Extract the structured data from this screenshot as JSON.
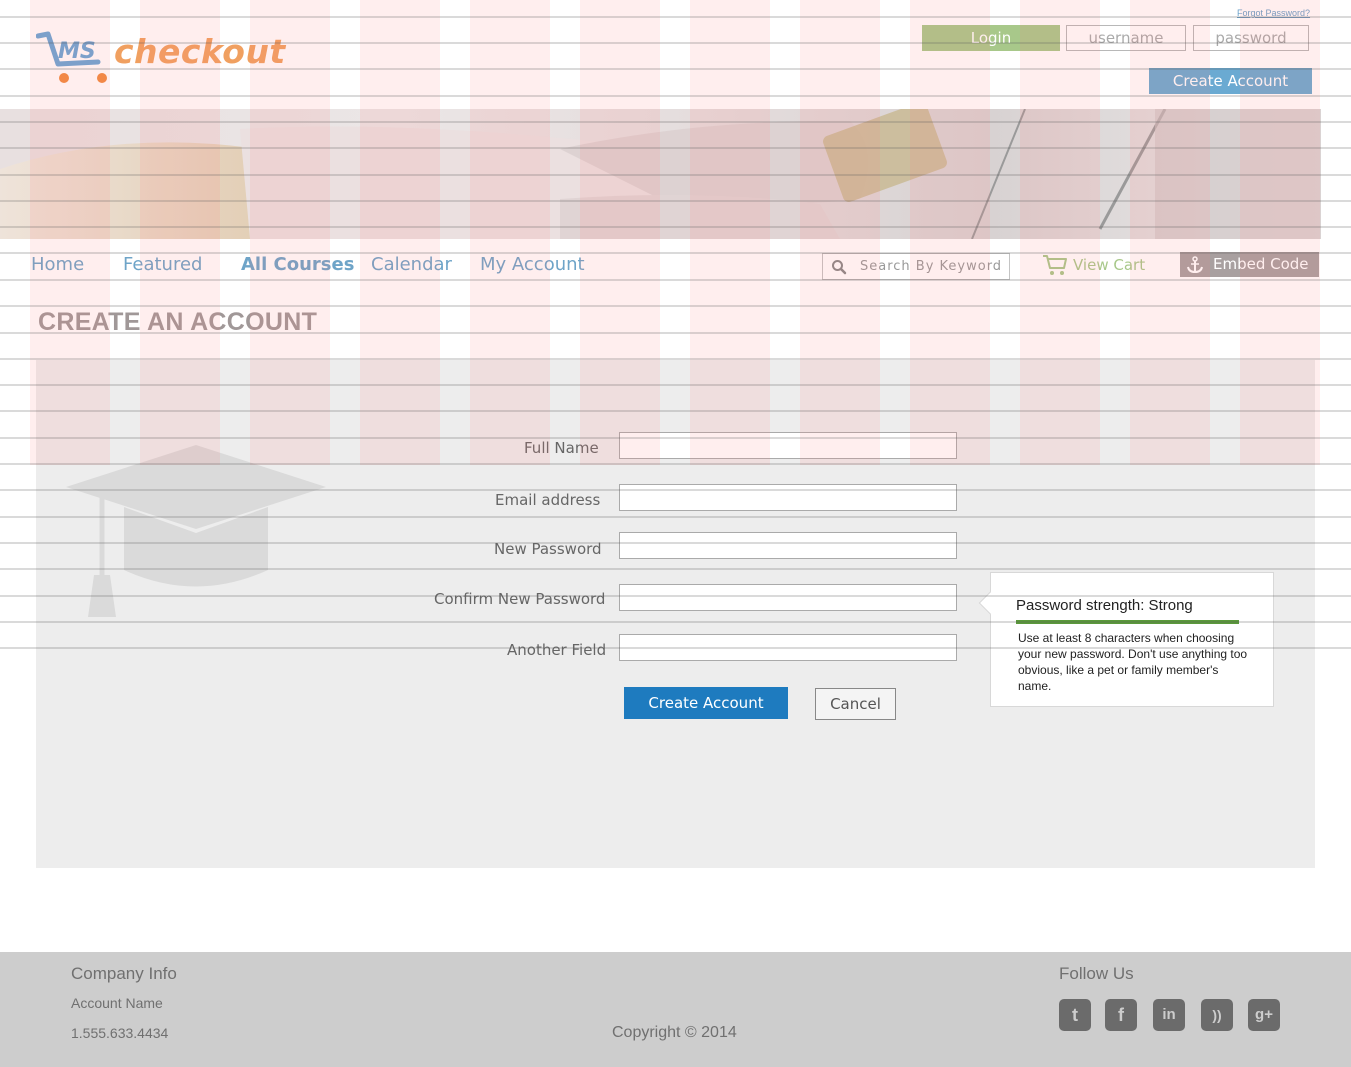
{
  "brand": {
    "logo_text": "checkout",
    "mark_text": "lms"
  },
  "header": {
    "forgot_password": "Forgot Password?",
    "login_label": "Login",
    "username_placeholder": "username",
    "password_placeholder": "password",
    "create_account_label": "Create  Account"
  },
  "nav": {
    "items": [
      {
        "label": "Home"
      },
      {
        "label": "Featured"
      },
      {
        "label": "All Courses"
      },
      {
        "label": "Calendar"
      },
      {
        "label": "My Account"
      }
    ],
    "search_placeholder": "Search By Keyword",
    "cart_label": "View Cart",
    "embed_label": "Embed Code"
  },
  "page": {
    "title": "CREATE AN ACCOUNT"
  },
  "form": {
    "fields": [
      {
        "label": "Full Name",
        "value": ""
      },
      {
        "label": "Email address",
        "value": ""
      },
      {
        "label": "New Password",
        "value": ""
      },
      {
        "label": "Confirm New Password",
        "value": ""
      },
      {
        "label": "Another Field",
        "value": ""
      }
    ],
    "submit_label": "Create  Account",
    "cancel_label": "Cancel"
  },
  "tooltip": {
    "title": "Password strength: Strong",
    "text": "Use at least 8 characters when choosing your new password.  Don't use anything too obvious, like a pet or family member's name."
  },
  "footer": {
    "company_heading": "Company Info",
    "account_name": "Account Name",
    "phone": "1.555.633.4434",
    "copyright": "Copyright © 2014",
    "follow_heading": "Follow Us",
    "social": [
      {
        "icon": "twitter-icon",
        "glyph": "t"
      },
      {
        "icon": "facebook-icon",
        "glyph": "f"
      },
      {
        "icon": "linkedin-icon",
        "glyph": "in"
      },
      {
        "icon": "rss-icon",
        "glyph": "))"
      },
      {
        "icon": "google-plus-icon",
        "glyph": "g+"
      }
    ]
  },
  "colors": {
    "accent_blue": "#1e7bbf",
    "nav_blue": "#6ea4c8",
    "login_green": "#a8c88a",
    "logo_orange": "#f0a060",
    "strength_green": "#5a9a3a"
  }
}
